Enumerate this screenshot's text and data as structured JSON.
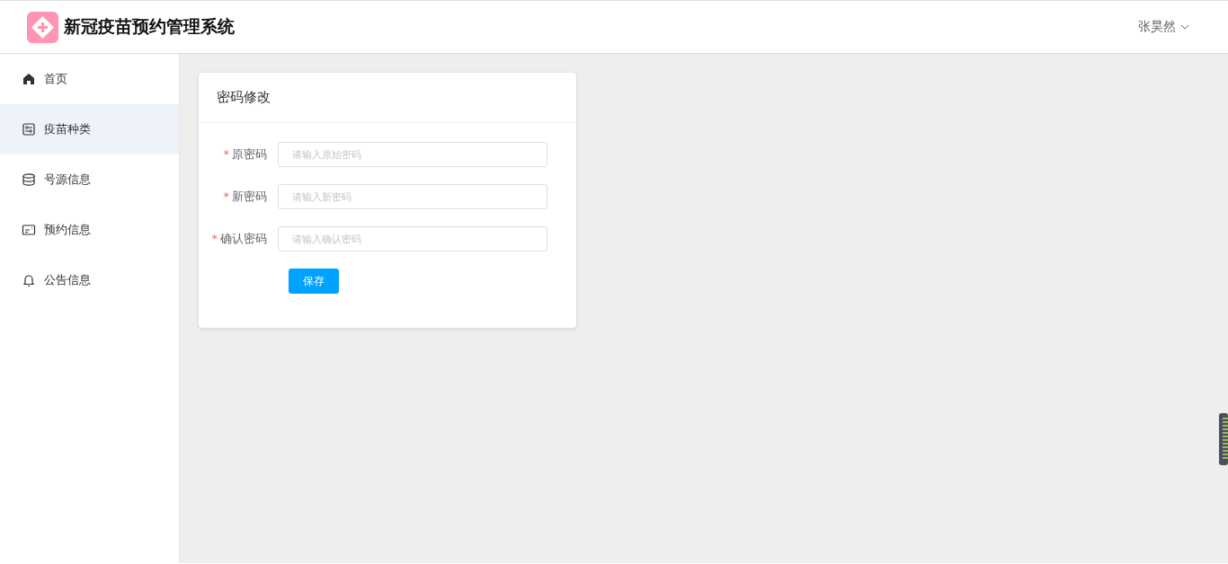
{
  "header": {
    "title": "新冠疫苗预约管理系统",
    "user": "张昊然"
  },
  "sidebar": {
    "items": [
      {
        "label": "首页",
        "selected": false
      },
      {
        "label": "疫苗种类",
        "selected": true
      },
      {
        "label": "号源信息",
        "selected": false
      },
      {
        "label": "预约信息",
        "selected": false
      },
      {
        "label": "公告信息",
        "selected": false
      }
    ]
  },
  "card": {
    "title": "密码修改",
    "fields": [
      {
        "required_mark": "*",
        "label": "原密码",
        "placeholder": "请输入原始密码"
      },
      {
        "required_mark": "*",
        "label": "新密码",
        "placeholder": "请输入新密码"
      },
      {
        "required_mark": "*",
        "label": "确认密码",
        "placeholder": "请输入确认密码"
      }
    ],
    "button": "保存"
  }
}
